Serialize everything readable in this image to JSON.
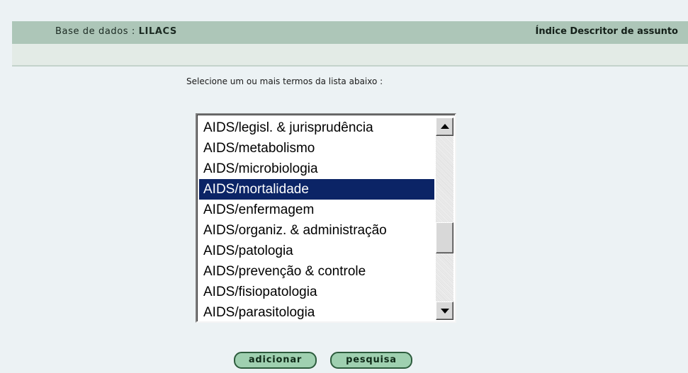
{
  "header": {
    "db_label": "Base de dados :",
    "db_value": "LILACS",
    "index_title": "Índice Descritor de assunto"
  },
  "instruction": "Selecione um ou mais termos da lista abaixo :",
  "listbox": {
    "selected_value": "AIDS/mortalidade",
    "options": [
      "AIDS/legisl. & jurisprudência",
      "AIDS/metabolismo",
      "AIDS/microbiologia",
      "AIDS/mortalidade",
      "AIDS/enfermagem",
      "AIDS/organiz. & administração",
      "AIDS/patologia",
      "AIDS/prevenção & controle",
      "AIDS/fisiopatologia",
      "AIDS/parasitologia"
    ]
  },
  "buttons": {
    "add_label": "adicionar",
    "search_label": "pesquisa"
  },
  "colors": {
    "page_background": "#ecf2f4",
    "header_band": "#adc6b8",
    "selection": "#0b2466",
    "button_fill": "#9fd0b0",
    "button_border": "#2d5c3d"
  },
  "icons": {
    "scroll_up": "triangle-up-icon",
    "scroll_down": "triangle-down-icon"
  }
}
